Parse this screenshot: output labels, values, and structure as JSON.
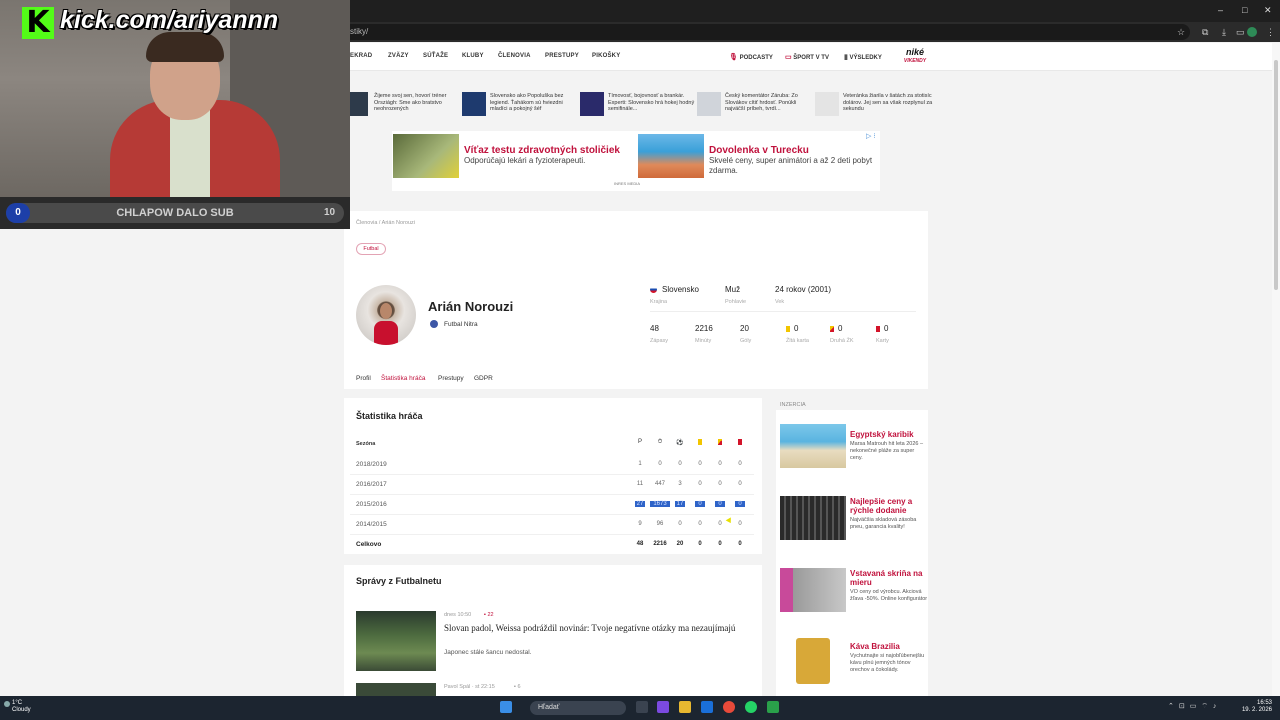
{
  "browser": {
    "url": "stiky/",
    "window_controls": [
      "–",
      "□",
      "✕"
    ]
  },
  "site_nav": {
    "items": [
      "EKRAD",
      "ZVÄZY",
      "SÚŤAŽE",
      "KLUBY",
      "ČLENOVIA",
      "PRESTUPY",
      "PIKOŠKY"
    ],
    "right": [
      "PODCASTY",
      "ŠPORT V TV",
      "VÝSLEDKY"
    ],
    "logo": "niké",
    "logo_sub": "VIKENDY"
  },
  "news_strip": [
    "Žijeme svoj sen, hovorí tréner Orsziágh: Sme ako bratstvo neohrozených",
    "Slovensko ako Popoluška bez legiend. Ťahákom sú hviezdni mladíci a pokojný šéf",
    "Tímovosť, bojovnosť a brankár. Experti: Slovensko hrá hokej hodný semifinále...",
    "Český komentátor Záruba: Zo Slovákov cítiť hrdosť. Ponúkli najväčší príbeh, tvrdí...",
    "Veteránka žiarila v šatách za stotisíc dolárov. Jej sen sa však rozplynul za sekundu"
  ],
  "ad": {
    "left_title": "Víťaz testu zdravotných stoličiek",
    "left_desc": "Odporúčajú lekári a fyzioterapeuti.",
    "right_title": "Dovolenka v Turecku",
    "right_desc": "Skvelé ceny, super animátori a až 2 deti pobyt zdarma.",
    "footer": "INRES MEDIA",
    "choice": "▷ ⁝"
  },
  "profile": {
    "breadcrumb": "Členovia  /  Arián Norouzi",
    "tag": "Futbal",
    "name": "Arián Norouzi",
    "club": "Futbal Nitra",
    "info": [
      {
        "value": "Slovensko",
        "label": "Krajina"
      },
      {
        "value": "Muž",
        "label": "Pohlavie"
      },
      {
        "value": "24 rokov (2001)",
        "label": "Vek"
      }
    ],
    "stats": [
      {
        "value": "48",
        "label": "Zápasy"
      },
      {
        "value": "2216",
        "label": "Minúty"
      },
      {
        "value": "20",
        "label": "Góly"
      },
      {
        "value": "0",
        "label": "Žltá karta"
      },
      {
        "value": "0",
        "label": "Druhá ŽK"
      },
      {
        "value": "0",
        "label": "Karty"
      }
    ],
    "tabs": [
      "Profil",
      "Štatistika hráča",
      "Prestupy",
      "GDPR"
    ]
  },
  "stats_table": {
    "title": "Štatistika hráča",
    "season_header": "Sezóna",
    "headers": [
      "P",
      "⏱",
      "⚽",
      "",
      "",
      ""
    ],
    "rows": [
      {
        "season": "2018/2019",
        "values": [
          "1",
          "0",
          "0",
          "0",
          "0",
          "0"
        ]
      },
      {
        "season": "2016/2017",
        "values": [
          "11",
          "447",
          "3",
          "0",
          "0",
          "0"
        ]
      },
      {
        "season": "2015/2016",
        "values": [
          "27",
          "1673",
          "17",
          "0",
          "0",
          "0"
        ]
      },
      {
        "season": "2014/2015",
        "values": [
          "9",
          "96",
          "0",
          "0",
          "0",
          "0"
        ]
      },
      {
        "season": "Celkovo",
        "values": [
          "48",
          "2216",
          "20",
          "0",
          "0",
          "0"
        ]
      }
    ]
  },
  "news": {
    "title": "Správy z Futbalnetu",
    "items": [
      {
        "meta": "dnes 10:50",
        "comments": "22",
        "headline": "Slovan padol, Weissa podráždil novinár: Tvoje negatívne otázky ma nezaujímajú",
        "sub": "Japonec stále šancu nedostal."
      },
      {
        "meta": "Pavol Spál  ·  st 22:15",
        "comments": "6"
      }
    ]
  },
  "sidebar": {
    "label": "INZERCIA",
    "items": [
      {
        "title": "Egyptský karibik",
        "desc": "Marsa Matrouh hit leta 2026 – nekonečné pláže za super ceny."
      },
      {
        "title": "Najlepšie ceny a rýchle dodanie",
        "desc": "Najväčšia skladová zásoba pneu, garancia kvality!"
      },
      {
        "title": "Vstavaná skriňa na mieru",
        "desc": "VO ceny od výrobcu. Akciová žľava -50%. Online konfigurátor"
      },
      {
        "title": "Káva Brazilia",
        "desc": "Vychutnajte si najobľúbenejšiu kávu plnú jemných tónov orechov a čokolády."
      }
    ]
  },
  "stream": {
    "kick_url": "kick.com/ariyannn",
    "sub_current": "0",
    "sub_text": "CHLAPOW DALO SUB",
    "sub_goal": "10"
  },
  "taskbar": {
    "weather_temp": "1°C",
    "weather_desc": "Cloudy",
    "search": "Hľadať",
    "time": "16:53",
    "date": "19. 2. 2026"
  },
  "colors": {
    "accent": "#c0113c",
    "kick": "#53fc18",
    "selection": "#2e63c8"
  }
}
